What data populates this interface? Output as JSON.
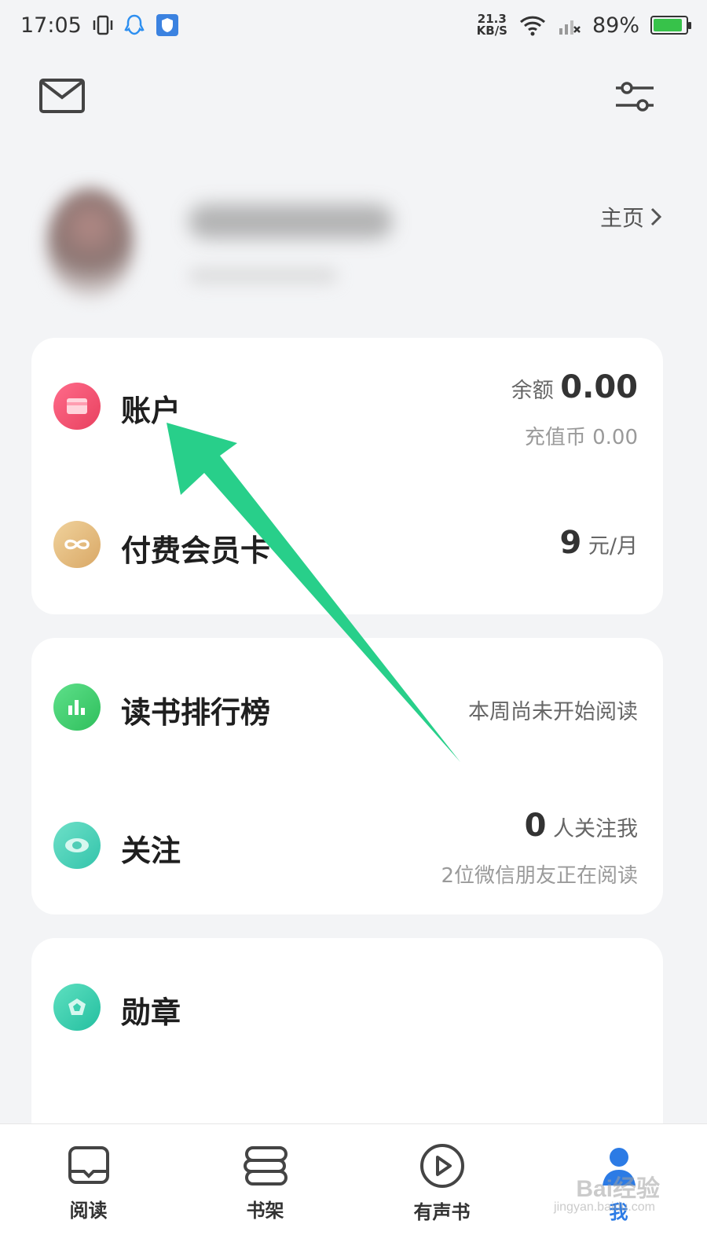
{
  "status_bar": {
    "time": "17:05",
    "speed_value": "21.3",
    "speed_unit": "KB/S",
    "battery": "89%",
    "battery_level": 0.89
  },
  "profile": {
    "homepage_label": "主页"
  },
  "account_card": {
    "account_label": "账户",
    "balance_label": "余额",
    "balance_value": "0.00",
    "coins_label": "充值币 0.00",
    "membership_label": "付费会员卡",
    "membership_price": "9",
    "membership_unit": "元/月"
  },
  "social_card": {
    "ranking_label": "读书排行榜",
    "ranking_status": "本周尚未开始阅读",
    "follow_label": "关注",
    "followers_count": "0",
    "followers_text": "人关注我",
    "friends_reading": "2位微信朋友正在阅读"
  },
  "badge_card": {
    "badge_label": "勋章"
  },
  "bottom_nav": {
    "items": [
      {
        "label": "阅读"
      },
      {
        "label": "书架"
      },
      {
        "label": "有声书"
      },
      {
        "label": "我"
      }
    ]
  },
  "watermark": {
    "brand": "Bai经验",
    "url": "jingyan.baidu.com"
  },
  "colors": {
    "account_icon": "#f0506e",
    "membership_icon": "#e8c48b",
    "ranking_icon": "#3dcf6c",
    "follow_icon": "#3ccfb8",
    "badge_icon": "#2ecfaa",
    "arrow": "#28cf8a",
    "active_tab": "#2c7be5"
  },
  "icons": {
    "mail": "mail-icon",
    "settings": "settings-sliders-icon",
    "account": "wallet-icon",
    "membership": "infinity-icon",
    "ranking": "bar-chart-icon",
    "follow": "eye-icon",
    "badge": "medal-icon"
  }
}
